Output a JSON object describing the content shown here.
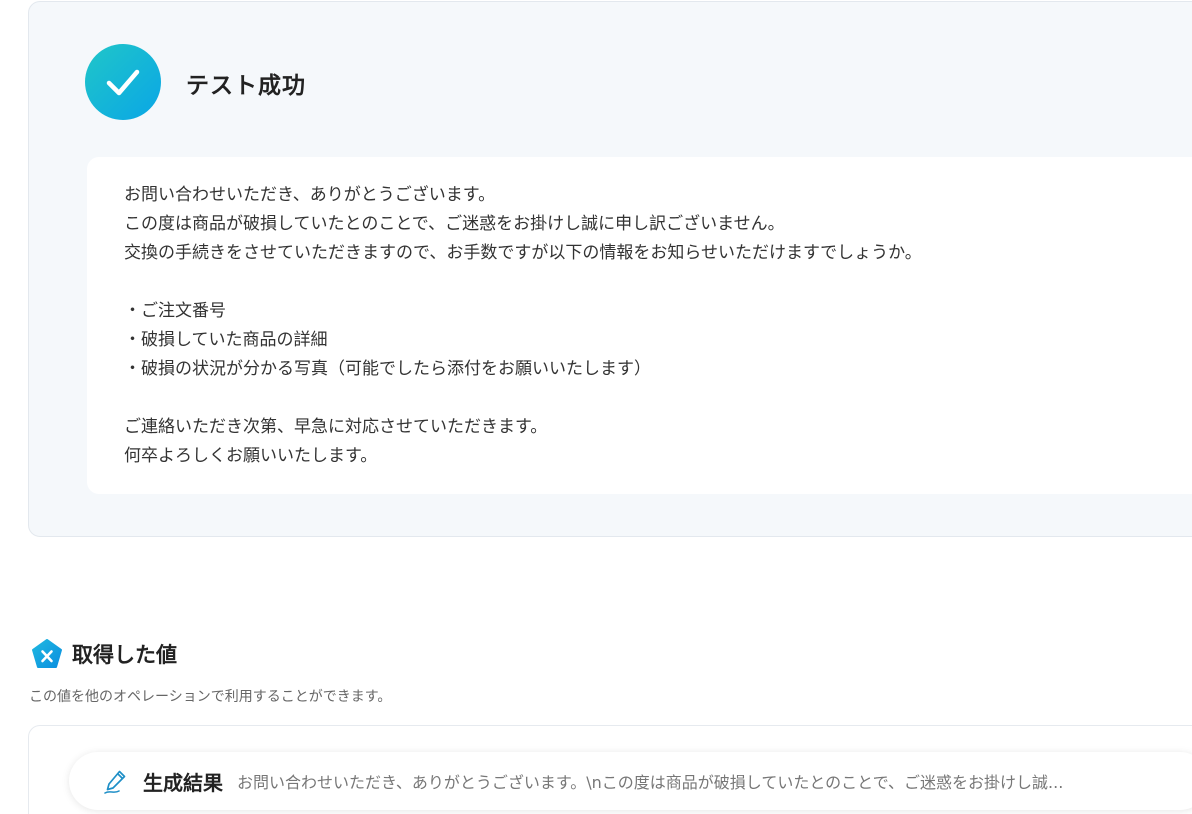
{
  "test_result": {
    "status_icon": "checkmark-icon",
    "title": "テスト成功",
    "output_lines": [
      "お問い合わせいただき、ありがとうございます。",
      "この度は商品が破損していたとのことで、ご迷惑をお掛けし誠に申し訳ございません。",
      "交換の手続きをさせていただきますので、お手数ですが以下の情報をお知らせいただけますでしょうか。",
      "",
      "・ご注文番号",
      "・破損していた商品の詳細",
      "・破損の状況が分かる写真（可能でしたら添付をお願いいたします）",
      "",
      "ご連絡いただき次第、早急に対応させていただきます。",
      "何卒よろしくお願いいたします。"
    ]
  },
  "acquired_values": {
    "icon": "variable-icon",
    "title": "取得した値",
    "description": "この値を他のオペレーションで利用することができます。",
    "items": [
      {
        "icon": "pen-icon",
        "label": "生成結果",
        "value": "お問い合わせいただき、ありがとうございます。\\nこの度は商品が破損していたとのことで、ご迷惑をお掛けし誠..."
      }
    ]
  },
  "colors": {
    "accent_start": "#20c6c8",
    "accent_end": "#0aa6e6",
    "card_background": "#f5f8fb"
  }
}
